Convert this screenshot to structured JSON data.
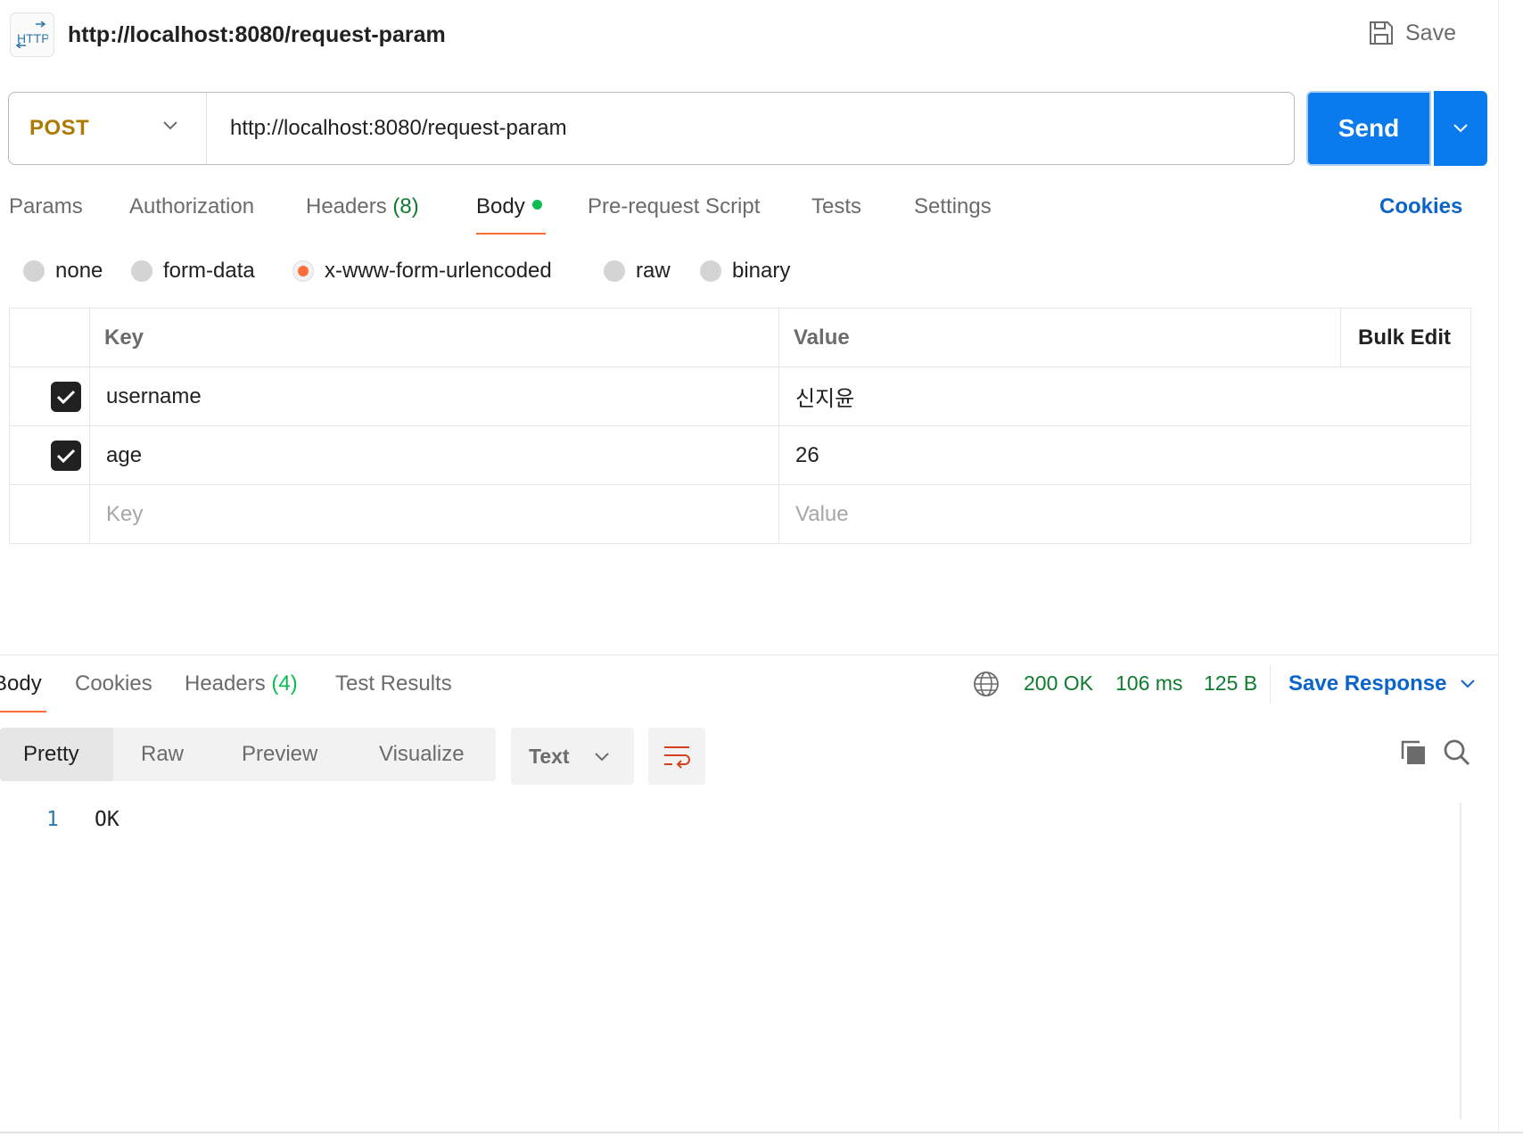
{
  "header": {
    "icon": "http-icon",
    "icon_text": "HTTP",
    "title": "http://localhost:8080/request-param",
    "save_label": "Save"
  },
  "request": {
    "method": "POST",
    "url": "http://localhost:8080/request-param",
    "send_label": "Send"
  },
  "request_tabs": {
    "params": "Params",
    "authorization": "Authorization",
    "headers": "Headers",
    "headers_count": "(8)",
    "body": "Body",
    "pre_request": "Pre-request Script",
    "tests": "Tests",
    "settings": "Settings",
    "active": "Body",
    "cookies": "Cookies"
  },
  "body_types": {
    "none": "none",
    "form_data": "form-data",
    "urlencoded": "x-www-form-urlencoded",
    "raw": "raw",
    "binary": "binary",
    "selected": "x-www-form-urlencoded"
  },
  "table": {
    "key_header": "Key",
    "value_header": "Value",
    "bulk_edit": "Bulk Edit",
    "rows": [
      {
        "key": "username",
        "value": "신지윤",
        "checked": true
      },
      {
        "key": "age",
        "value": "26",
        "checked": true
      }
    ],
    "placeholder_key": "Key",
    "placeholder_value": "Value"
  },
  "response": {
    "tabs": {
      "body": "Body",
      "cookies": "Cookies",
      "headers": "Headers",
      "headers_count": "(4)",
      "test_results": "Test Results"
    },
    "status": "200 OK",
    "time": "106 ms",
    "size": "125 B",
    "save_response": "Save Response",
    "view_modes": {
      "pretty": "Pretty",
      "raw": "Raw",
      "preview": "Preview",
      "visualize": "Visualize",
      "active": "Pretty"
    },
    "format": "Text",
    "lines": [
      {
        "num": "1",
        "text": "OK"
      }
    ]
  },
  "colors": {
    "accent": "#097bed",
    "method": "#ad7a03",
    "active_tab_underline": "#ff6c37",
    "status_green": "#0f7b2e",
    "link_blue": "#0b64c9"
  }
}
